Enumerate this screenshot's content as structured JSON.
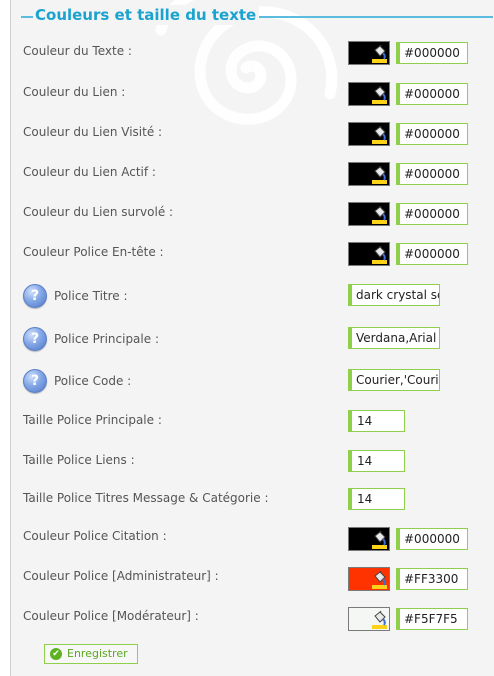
{
  "section": {
    "title": "Couleurs et taille du texte"
  },
  "color_rows": [
    {
      "label": "Couleur du Texte   :",
      "color": "#000000",
      "value": "#000000"
    },
    {
      "label": "Couleur du Lien   :",
      "color": "#000000",
      "value": "#000000"
    },
    {
      "label": "Couleur du Lien Visité   :",
      "color": "#000000",
      "value": "#000000"
    },
    {
      "label": "Couleur du Lien Actif   :",
      "color": "#000000",
      "value": "#000000"
    },
    {
      "label": "Couleur du Lien survolé   :",
      "color": "#000000",
      "value": "#000000"
    },
    {
      "label": "Couleur Police En-tête   :",
      "color": "#000000",
      "value": "#000000"
    }
  ],
  "font_rows": [
    {
      "label": "Police Titre   :",
      "value": "dark crystal script",
      "icon": "help-icon"
    },
    {
      "label": "Police Principale   :",
      "value": "Verdana,Arial",
      "icon": "help-icon"
    },
    {
      "label": "Police Code   :",
      "value": "Courier,'Courier New'",
      "icon": "help-icon"
    }
  ],
  "size_rows": [
    {
      "label": "Taille Police Principale   :",
      "value": "14"
    },
    {
      "label": "Taille Police Liens   :",
      "value": "14"
    },
    {
      "label": "Taille Police Titres Message & Catégorie   :",
      "value": "14"
    }
  ],
  "role_color_rows": [
    {
      "label": "Couleur Police Citation   :",
      "color": "#000000",
      "value": "#000000"
    },
    {
      "label": "Couleur Police [Administrateur]   :",
      "color": "#FF3300",
      "value": "#FF3300"
    },
    {
      "label": "Couleur Police [Modérateur]   :",
      "color": "#F5F7F5",
      "value": "#F5F7F5"
    }
  ],
  "icons": {
    "help": "?",
    "bucket": "paint-bucket-icon",
    "save": "check-circle-icon"
  },
  "actions": {
    "save_label": "Enregistrer",
    "save_glyph": "✔"
  },
  "colors": {
    "accent": "#1aa3cf",
    "field_border": "#8fcf4a",
    "panel_bg": "#f4f4f4"
  }
}
